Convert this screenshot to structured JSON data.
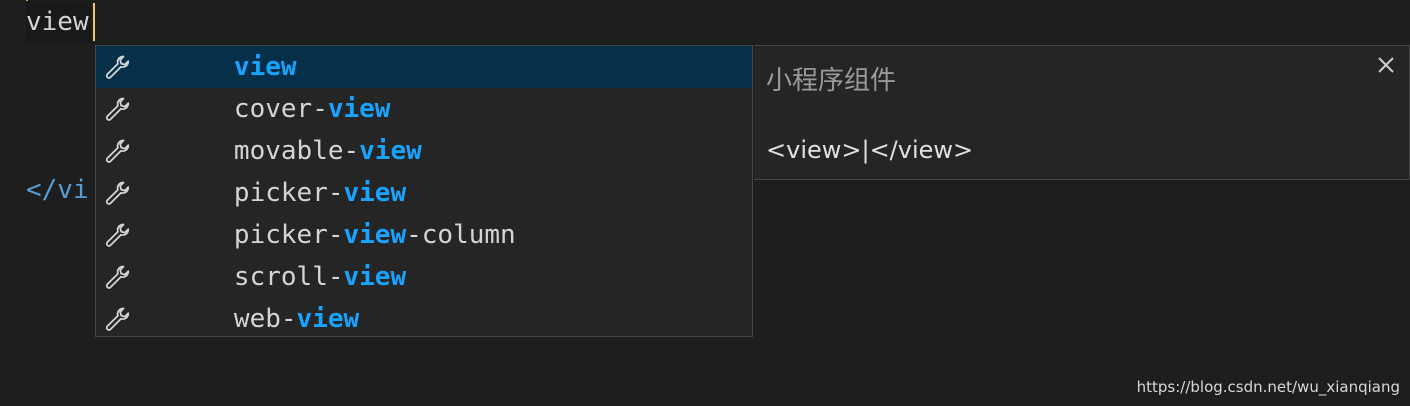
{
  "editor": {
    "typed_text": "view",
    "closing_tag_fragment": "</vi"
  },
  "suggestions": {
    "icon": "wrench-icon",
    "items": [
      {
        "prefix": "",
        "match": "view",
        "suffix": "",
        "selected": true
      },
      {
        "prefix": "cover-",
        "match": "view",
        "suffix": "",
        "selected": false
      },
      {
        "prefix": "movable-",
        "match": "view",
        "suffix": "",
        "selected": false
      },
      {
        "prefix": "picker-",
        "match": "view",
        "suffix": "",
        "selected": false
      },
      {
        "prefix": "picker-",
        "match": "view",
        "suffix": "-column",
        "selected": false
      },
      {
        "prefix": "scroll-",
        "match": "view",
        "suffix": "",
        "selected": false
      },
      {
        "prefix": "web-",
        "match": "view",
        "suffix": "",
        "selected": false
      }
    ]
  },
  "details": {
    "title": "小程序组件",
    "doc": "<view>|</view>",
    "close_icon": "close-icon"
  },
  "watermark": "https://blog.csdn.net/wu_xianqiang",
  "colors": {
    "background": "#1e1e1e",
    "widget_background": "#252526",
    "selection": "#062f4a",
    "highlight": "#18a3ff",
    "tag": "#569cd6",
    "cursor": "#e8c96b"
  }
}
